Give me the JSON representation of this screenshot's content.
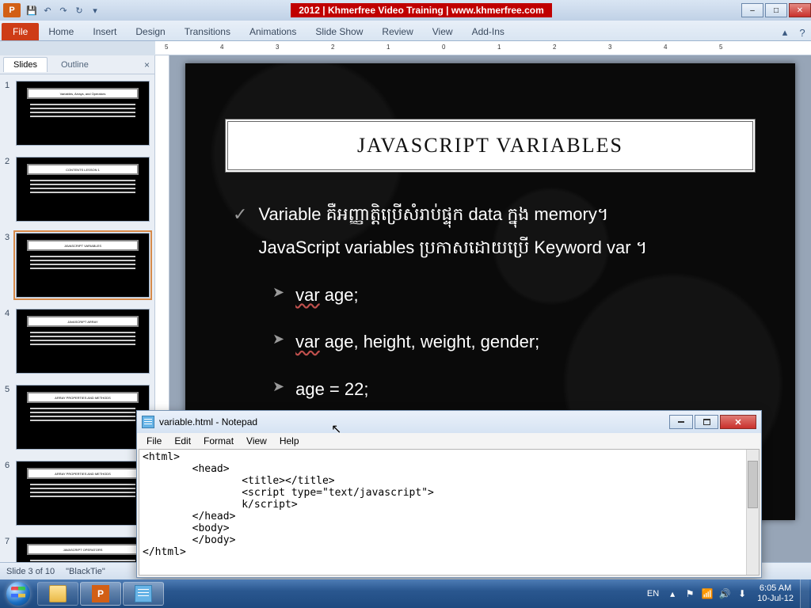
{
  "titlebar": {
    "text": "2012 | Khmerfree Video Training | www.khmerfree.com"
  },
  "qat": {
    "save": "💾",
    "undo": "↶",
    "redo": "↷",
    "refresh": "↻",
    "more": "▾"
  },
  "winctrl": {
    "min": "–",
    "max": "□",
    "close": "✕"
  },
  "ribbon": {
    "file": "File",
    "tabs": [
      "Home",
      "Insert",
      "Design",
      "Transitions",
      "Animations",
      "Slide Show",
      "Review",
      "View",
      "Add-Ins"
    ],
    "minimize": "▴",
    "help": "?"
  },
  "ruler_h": [
    "5",
    "4",
    "3",
    "2",
    "1",
    "0",
    "1",
    "2",
    "3",
    "4",
    "5"
  ],
  "thumbs": {
    "tab_slides": "Slides",
    "tab_outline": "Outline",
    "close": "×",
    "items": [
      {
        "n": "1",
        "title": "Variables, Arrays, and Operators"
      },
      {
        "n": "2",
        "title": "CONTENTS LESSON 1"
      },
      {
        "n": "3",
        "title": "JAVASCRIPT VARIABLES"
      },
      {
        "n": "4",
        "title": "JAVASCRIPT ARRAY"
      },
      {
        "n": "5",
        "title": "ARRAY PROPERTIES AND METHODS"
      },
      {
        "n": "6",
        "title": "ARRAY PROPERTIES AND METHODS"
      },
      {
        "n": "7",
        "title": "JAVASCRIPT OPERATORS"
      }
    ],
    "selected": 2
  },
  "slide": {
    "title": "JAVASCRIPT VARIABLES",
    "line1": "Variable គឺអញ្ញាត្តិប្រើសំរាប់ផ្ទុក data ក្នុង memory។",
    "line2": "JavaScript variables ប្រកាសដោយប្រើ Keyword var ។",
    "kw_var": "var",
    "b1": "var age;",
    "b2": "var age, height, weight, gender;",
    "b3": "age = 22;"
  },
  "status": {
    "slide": "Slide 3 of 10",
    "theme": "\"BlackTie\""
  },
  "notepad": {
    "title": "variable.html - Notepad",
    "menu": [
      "File",
      "Edit",
      "Format",
      "View",
      "Help"
    ],
    "content": "<html>\n        <head>\n                <title></title>\n                <script type=\"text/javascript\">\n                k/script>\n        </head>\n        <body>\n        </body>\n</html>"
  },
  "taskbar": {
    "lang": "EN",
    "tray_up": "▴",
    "tray_flag": "⚑",
    "tray_net": "📶",
    "tray_vol": "🔊",
    "tray_dbx": "⬇",
    "time": "6:05 AM",
    "date": "10-Jul-12"
  }
}
